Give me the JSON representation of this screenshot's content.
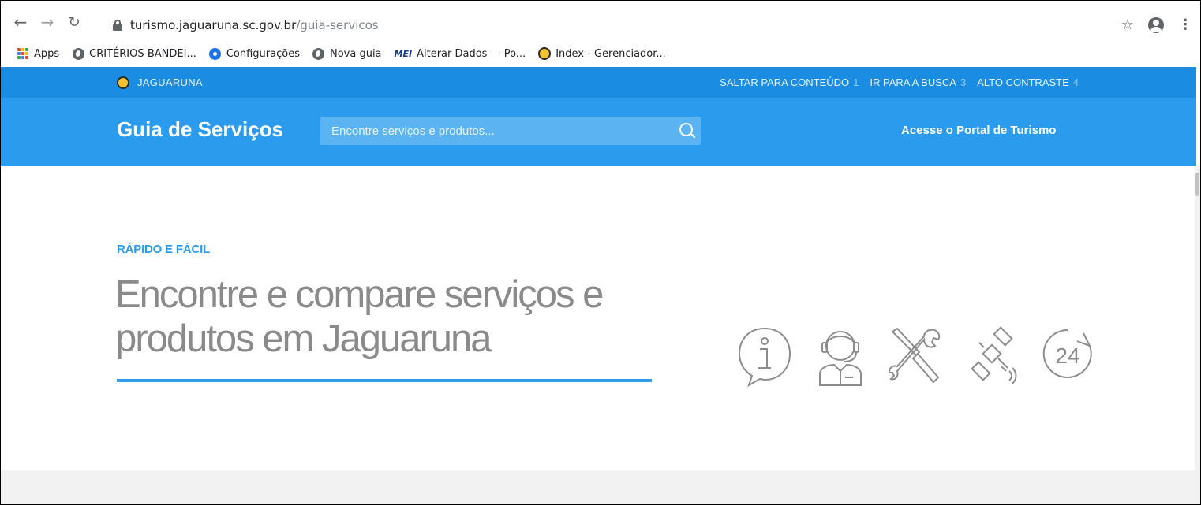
{
  "browser": {
    "url_host": "turismo.jaguaruna.sc.gov.br",
    "url_path": "/guia-servicos",
    "icons": [
      "back-icon",
      "forward-icon",
      "reload-icon",
      "lock-icon",
      "star-icon",
      "profile-icon",
      "menu-icon"
    ]
  },
  "bookmarks": [
    {
      "label": "Apps",
      "icon": "apps-grid-icon"
    },
    {
      "label": "CRITÉRIOS-BANDEI...",
      "icon": "globe-icon"
    },
    {
      "label": "Configurações",
      "icon": "gear-icon"
    },
    {
      "label": "Nova guia",
      "icon": "globe-icon"
    },
    {
      "label": "Alterar Dados — Po...",
      "icon": "mei-icon",
      "badge": "MEI"
    },
    {
      "label": "Index - Gerenciador...",
      "icon": "seal-icon"
    }
  ],
  "topbar": {
    "brand": "JAGUARUNA",
    "links": [
      {
        "label": "SALTAR PARA CONTEÚDO",
        "key": "1"
      },
      {
        "label": "IR PARA A BUSCA",
        "key": "3"
      },
      {
        "label": "ALTO CONTRASTE",
        "key": "4"
      }
    ]
  },
  "header": {
    "title": "Guia de Serviços",
    "search_placeholder": "Encontre serviços e produtos...",
    "portal_link": "Acesse o Portal de Turismo"
  },
  "hero": {
    "eyebrow": "RÁPIDO E FÁCIL",
    "title_line1": "Encontre e compare serviços e",
    "title_line2": "produtos em Jaguaruna",
    "icons": [
      "info-bubble-icon",
      "support-agent-icon",
      "tools-icon",
      "satellite-icon",
      "clock-24-icon"
    ],
    "clock_label": "24"
  },
  "colors": {
    "topbar": "#1a8de3",
    "header": "#2a9bed",
    "accent": "#2a9bed",
    "hero_text": "#8a8a8a",
    "footer_band": "#f2f2f2"
  }
}
